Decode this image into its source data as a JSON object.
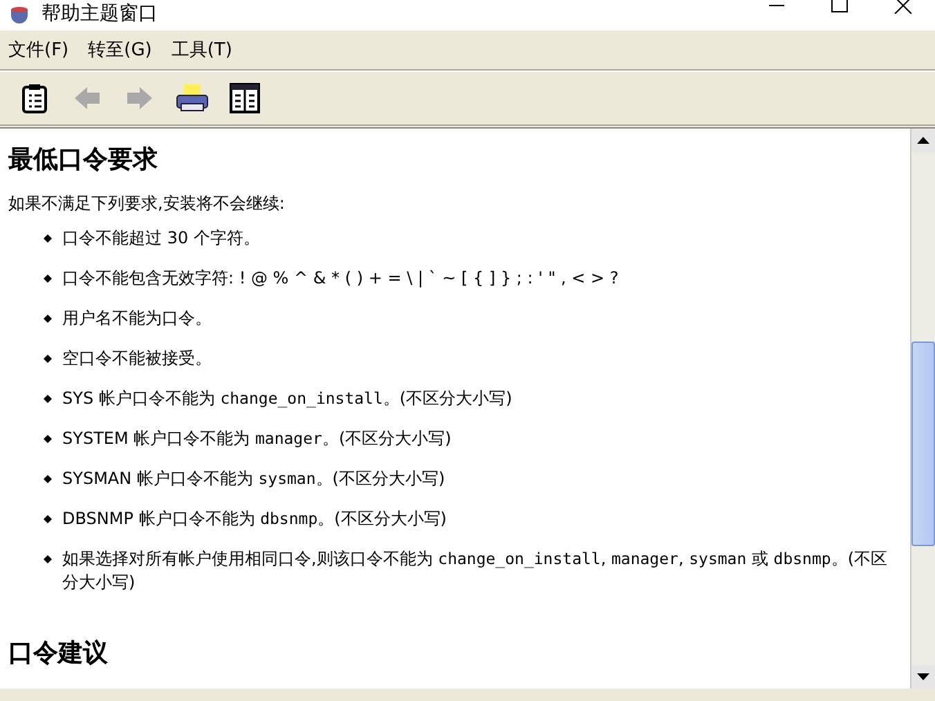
{
  "window": {
    "title": "帮助主题窗口"
  },
  "menu": [
    {
      "label": "文件(F)"
    },
    {
      "label": "转至(G)"
    },
    {
      "label": "工具(T)"
    }
  ],
  "toolbar": [
    {
      "kind": "contents",
      "disabled": false
    },
    {
      "kind": "back",
      "disabled": true
    },
    {
      "kind": "forward",
      "disabled": true
    },
    {
      "kind": "print",
      "disabled": false
    },
    {
      "kind": "index",
      "disabled": false
    }
  ],
  "content": {
    "heading": "最低口令要求",
    "intro": "如果不满足下列要求,安装将不会继续:",
    "items": [
      [
        {
          "kind": "text",
          "text": "口令不能超过 30 个字符。"
        }
      ],
      [
        {
          "kind": "text",
          "text": "口令不能包含无效字符: ! @ % ^ & * ( ) + = \\ | ` ~ [ { ] } ; : ' \" , < > ?"
        }
      ],
      [
        {
          "kind": "text",
          "text": "用户名不能为口令。"
        }
      ],
      [
        {
          "kind": "text",
          "text": "空口令不能被接受。"
        }
      ],
      [
        {
          "kind": "text",
          "text": "SYS 帐户口令不能为 "
        },
        {
          "kind": "code",
          "text": "change_on_install"
        },
        {
          "kind": "text",
          "text": "。(不区分大小写)"
        }
      ],
      [
        {
          "kind": "text",
          "text": "SYSTEM 帐户口令不能为 "
        },
        {
          "kind": "code",
          "text": "manager"
        },
        {
          "kind": "text",
          "text": "。(不区分大小写)"
        }
      ],
      [
        {
          "kind": "text",
          "text": "SYSMAN 帐户口令不能为 "
        },
        {
          "kind": "code",
          "text": "sysman"
        },
        {
          "kind": "text",
          "text": "。(不区分大小写)"
        }
      ],
      [
        {
          "kind": "text",
          "text": "DBSNMP 帐户口令不能为 "
        },
        {
          "kind": "code",
          "text": "dbsnmp"
        },
        {
          "kind": "text",
          "text": "。(不区分大小写)"
        }
      ],
      [
        {
          "kind": "text",
          "text": "如果选择对所有帐户使用相同口令,则该口令不能为 "
        },
        {
          "kind": "code",
          "text": "change_on_install"
        },
        {
          "kind": "text",
          "text": ", "
        },
        {
          "kind": "code",
          "text": "manager"
        },
        {
          "kind": "text",
          "text": ", "
        },
        {
          "kind": "code",
          "text": "sysman"
        },
        {
          "kind": "text",
          "text": " 或 "
        },
        {
          "kind": "code",
          "text": "dbsnmp"
        },
        {
          "kind": "text",
          "text": "。(不区分大小写)"
        }
      ]
    ],
    "heading2": "口令建议"
  }
}
